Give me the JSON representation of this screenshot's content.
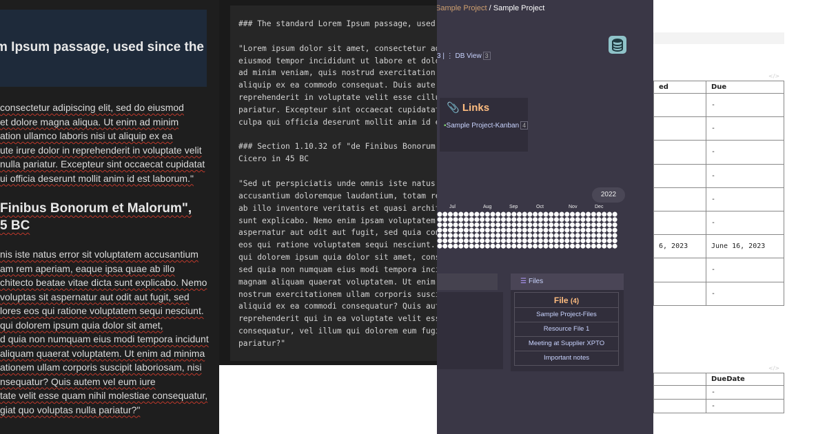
{
  "preview": {
    "callout_title": "m Ipsum passage, used since the",
    "para1": [
      " consectetur adipiscing elit, sed do eiusmod",
      "et dolore magna aliqua. Ut enim ad minim",
      "ation ullamco laboris nisi ut aliquip ex ea",
      "ute irure dolor in reprehenderit in voluptate velit",
      "nulla pariatur. Excepteur sint occaecat cupidatat",
      "ui officia deserunt mollit anim id est laborum.\""
    ],
    "heading": [
      "Finibus Bonorum et Malorum\",",
      "5 BC"
    ],
    "para2": [
      "nis iste natus error sit voluptatem accusantium",
      "am rem aperiam, eaque ipsa quae ab illo",
      "chitecto beatae vitae dicta sunt explicabo. Nemo",
      "voluptas sit aspernatur aut odit aut fugit, sed",
      "lores eos qui ratione voluptatem sequi nesciunt.",
      "qui dolorem ipsum quia dolor sit amet,",
      "d quia non numquam eius modi tempora incidunt",
      "aliquam quaerat voluptatem. Ut enim ad minima",
      "ationem ullam corporis suscipit laboriosam, nisi",
      "nsequatur? Quis autem vel eum iure",
      "tate velit esse quam nihil molestiae consequatur,",
      "giat quo voluptas nulla pariatur?\""
    ]
  },
  "source": {
    "code": "### The standard Lorem Ipsum passage, used\n\n\"Lorem ipsum dolor sit amet, consectetur ad\neiusmod tempor incididunt ut labore et dolo\nad minim veniam, quis nostrud exercitation\naliquip ex ea commodo consequat. Duis aute\nreprehenderit in voluptate velit esse cillu\npariatur. Excepteur sint occaecat cupidatat\nculpa qui officia deserunt mollit anim id e\n\n### Section 1.10.32 of \"de Finibus Bonorum\nCicero in 45 BC\n\n\"Sed ut perspiciatis unde omnis iste natus\naccusantium doloremque laudantium, totam re\nab illo inventore veritatis et quasi archit\nsunt explicabo. Nemo enim ipsam voluptatem\naspernatur aut odit aut fugit, sed quia con\neos qui ratione voluptatem sequi nesciunt.\nqui dolorem ipsum quia dolor sit amet, cons\nsed quia non numquam eius modi tempora inci\nmagnam aliquam quaerat voluptatem. Ut enim\nnostrum exercitationem ullam corporis susci\naliquid ex ea commodi consequatur? Quis aut\nreprehenderit qui in ea voluptate velit ess\nconsequatur, vel illum qui dolorem eum fugi\npariatur?\""
  },
  "dashboard": {
    "breadcrumb_parent": "Sample Project",
    "breadcrumb_sep": " / ",
    "breadcrumb_current": "Sample Project",
    "db_view_sep": "3 | ",
    "db_view_icon": "⋮",
    "db_view_label": " DB View",
    "db_view_count": "3",
    "links_title": "Links",
    "links_icon": "📎",
    "links_item_icon": "▪",
    "links_item": "Sample Project-Kanban",
    "links_item_count": "4",
    "year": "2022",
    "months": [
      "Jul",
      "Aug",
      "Sep",
      "Oct",
      "Nov",
      "Dec"
    ],
    "files_icon": "☰",
    "files_label": "Files",
    "file_table_title": "File",
    "file_table_count": "(4)",
    "file_rows": [
      "Sample Project-Files",
      "Resource File 1",
      "Meeting at Supplier XPTO",
      "Important notes"
    ],
    "colors": {
      "background": "#3a3746",
      "accent": "#ffbd80",
      "link": "#c9d4ff",
      "heatmap": "#ffffff"
    }
  },
  "tables": {
    "code_icon": "</>",
    "t1_headers": [
      "ed",
      "Due"
    ],
    "t1_rows": [
      [
        "",
        "-"
      ],
      [
        "",
        "-"
      ],
      [
        "",
        "-"
      ],
      [
        "",
        "-"
      ],
      [
        "",
        "-"
      ],
      [
        "",
        "-"
      ],
      [
        "6, 2023",
        "June 16, 2023"
      ],
      [
        "",
        "-"
      ],
      [
        "",
        "-"
      ]
    ],
    "t2_headers": [
      "",
      "DueDate"
    ],
    "t2_rows": [
      [
        "",
        "-"
      ],
      [
        "",
        "-"
      ]
    ]
  }
}
